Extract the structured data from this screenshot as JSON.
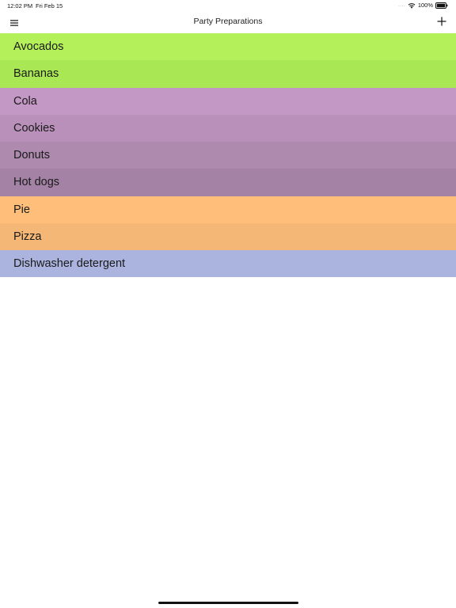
{
  "status_bar": {
    "time": "12:02 PM",
    "date": "Fri Feb 15",
    "signal": "....",
    "battery_percent": "100%",
    "icons": [
      "wifi-icon",
      "battery-icon"
    ]
  },
  "nav": {
    "title": "Party Preparations",
    "menu_icon": "hamburger-menu-icon",
    "add_icon": "plus-icon"
  },
  "list": {
    "items": [
      {
        "label": "Avocados",
        "color": "#b4f05a"
      },
      {
        "label": "Bananas",
        "color": "#aae754"
      },
      {
        "label": "Cola",
        "color": "#c498c4"
      },
      {
        "label": "Cookies",
        "color": "#b990b9"
      },
      {
        "label": "Donuts",
        "color": "#ae8aae"
      },
      {
        "label": "Hot dogs",
        "color": "#a482a5"
      },
      {
        "label": "Pie",
        "color": "#ffbf7a"
      },
      {
        "label": "Pizza",
        "color": "#f4b776"
      },
      {
        "label": "Dishwasher detergent",
        "color": "#aab4de"
      }
    ]
  }
}
